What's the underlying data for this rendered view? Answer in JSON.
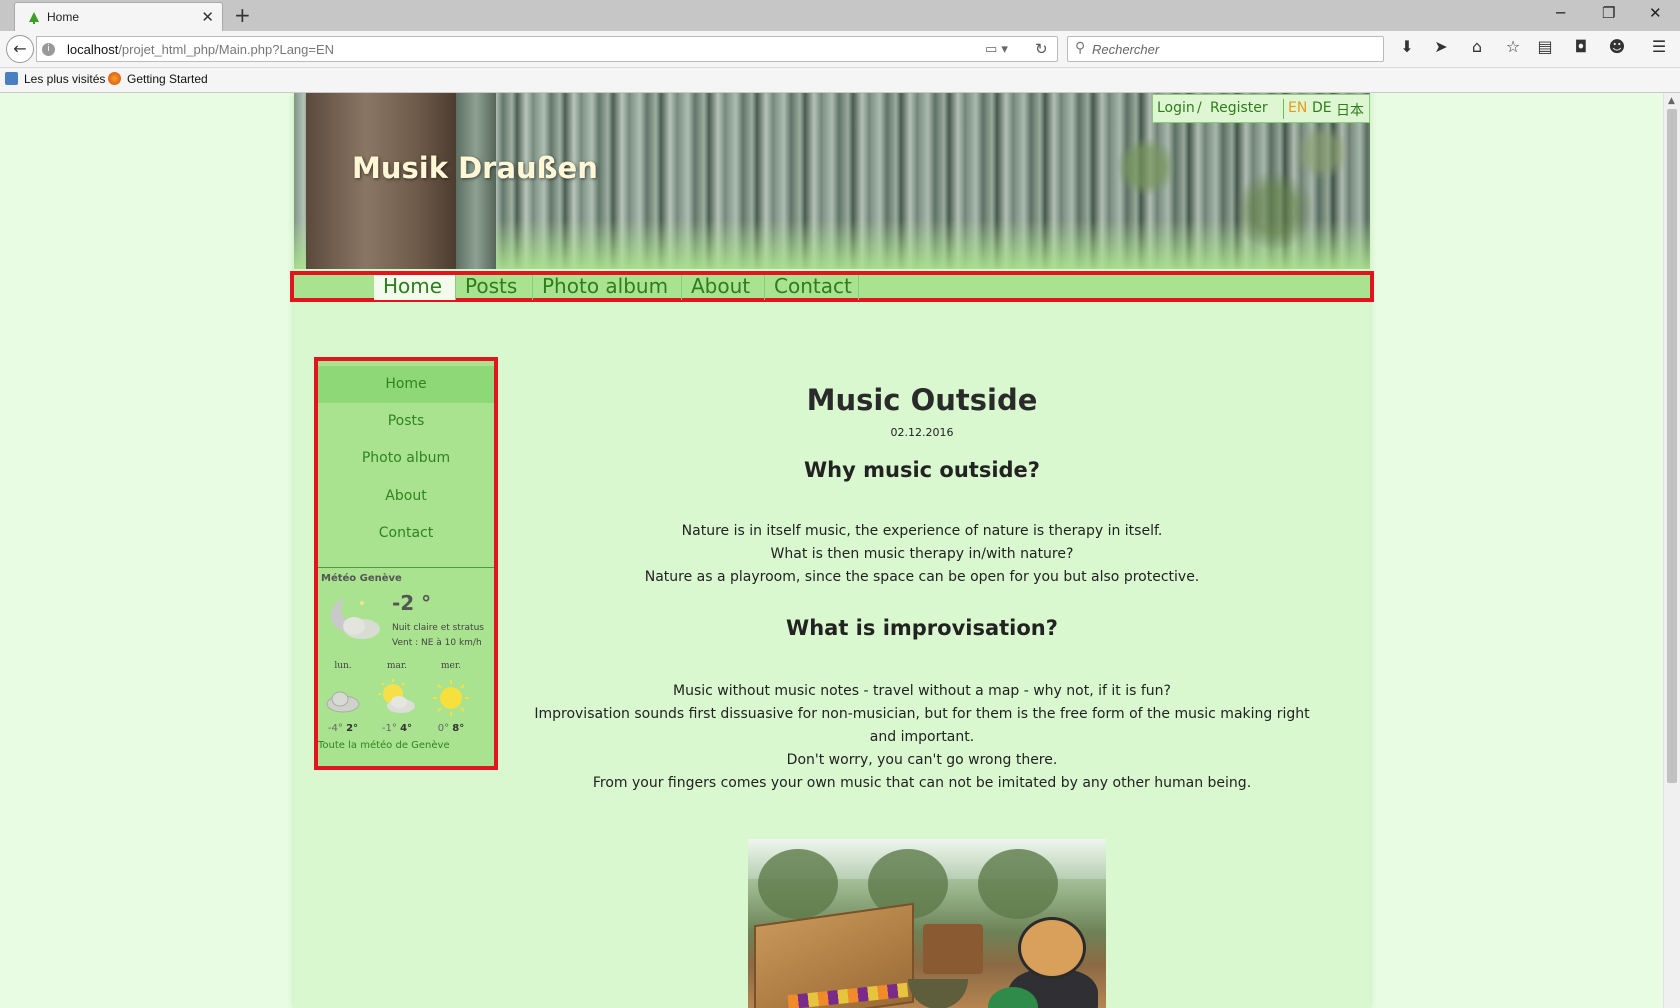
{
  "browser": {
    "tab_title": "Home",
    "url_host": "localhost",
    "url_path": "/projet_html_php/Main.php?Lang=EN",
    "search_placeholder": "Rechercher",
    "bookmarks": [
      {
        "label": "Les plus visités",
        "icon": "most-visited-icon"
      },
      {
        "label": "Getting Started",
        "icon": "firefox-icon"
      }
    ]
  },
  "site": {
    "title": "Musik Draußen",
    "auth": {
      "login": "Login",
      "separator": "/",
      "register": "Register"
    },
    "languages": [
      {
        "code": "EN",
        "active": true
      },
      {
        "code": "DE",
        "active": false
      },
      {
        "code": "日本",
        "active": false
      }
    ],
    "topnav": [
      {
        "label": "Home",
        "active": true
      },
      {
        "label": "Posts",
        "active": false
      },
      {
        "label": "Photo album",
        "active": false
      },
      {
        "label": "About",
        "active": false
      },
      {
        "label": "Contact",
        "active": false
      }
    ],
    "sidenav": [
      {
        "label": "Home",
        "active": true
      },
      {
        "label": "Posts",
        "active": false
      },
      {
        "label": "Photo album",
        "active": false
      },
      {
        "label": "About",
        "active": false
      },
      {
        "label": "Contact",
        "active": false
      }
    ],
    "highlight_color": "#e2141e",
    "accent_color": "#2d7d1c",
    "active_lang_color": "#e89a17"
  },
  "weather": {
    "title": "Météo Genève",
    "current_temp": "-2 °",
    "condition": "Nuit claire et stratus",
    "wind": "Vent : NE à 10 km/h",
    "current_icon": "moon-cloud-icon",
    "forecast": [
      {
        "day": "lun.",
        "min": "-4°",
        "max": "2°",
        "icon": "cloud-icon"
      },
      {
        "day": "mar.",
        "min": "-1°",
        "max": "4°",
        "icon": "sun-cloud-icon"
      },
      {
        "day": "mer.",
        "min": "0°",
        "max": "8°",
        "icon": "sun-icon"
      }
    ],
    "link": "Toute la météo de Genève"
  },
  "post": {
    "title": "Music Outside",
    "date": "02.12.2016",
    "heading1": "Why music outside?",
    "para1": [
      "Nature is in itself music, the experience of nature is therapy in itself.",
      "What is then music therapy in/with nature?",
      "Nature as a playroom, since the space can be open for you but also protective."
    ],
    "heading2": "What is improvisation?",
    "para2": [
      "Music without music notes - travel without a map - why not, if it is fun?",
      "Improvisation sounds first dissuasive for non-musician, but for them is the free form of the music making right",
      "and important.",
      "Don't worry, you can't go wrong there.",
      "From your fingers comes your own music that can not be imitated by any other human being."
    ],
    "image_subject": "instruments-photo"
  }
}
